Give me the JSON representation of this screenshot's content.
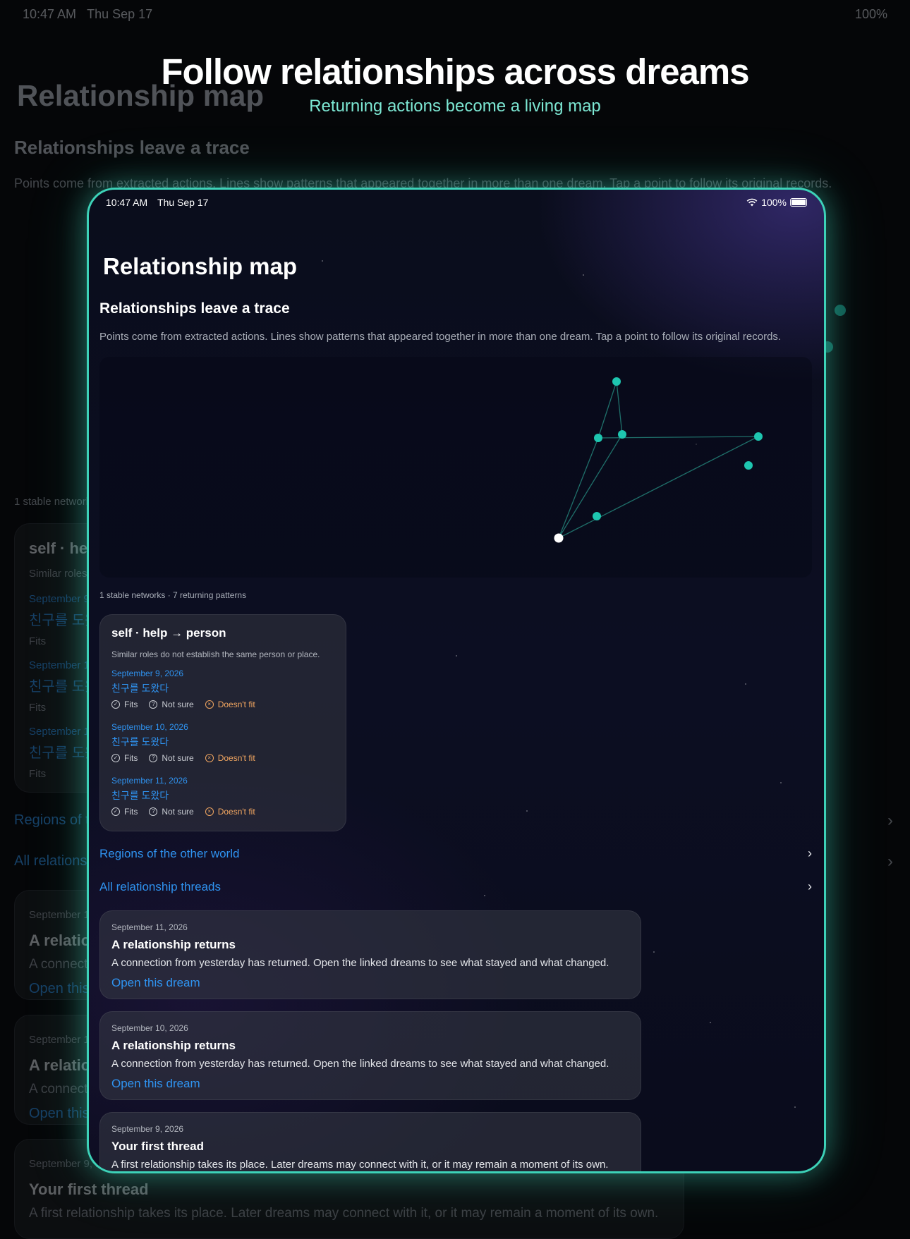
{
  "hero": {
    "title": "Follow relationships across dreams",
    "subtitle": "Returning actions become a living map"
  },
  "status_bar": {
    "time": "10:47 AM",
    "date": "Thu Sep 17",
    "battery": "100%",
    "wifi_icon": "wifi-icon",
    "battery_icon": "battery-icon"
  },
  "page": {
    "title": "Relationship map",
    "section_heading": "Relationships leave a trace",
    "section_description": "Points come from extracted actions. Lines show patterns that appeared together in more than one dream. Tap a point to follow its original records.",
    "network_summary": "1 stable networks · 7 returning patterns"
  },
  "map": {
    "accent_color": "#1ec6b0",
    "selected_color": "#ffffff",
    "line_color": "#1f6f6a"
  },
  "pattern_card": {
    "title": "self · help → person",
    "subtitle": "Similar roles do not establish the same person or place.",
    "occurrences": [
      {
        "date": "September 9, 2026",
        "text": "친구를 도왔다"
      },
      {
        "date": "September 10, 2026",
        "text": "친구를 도왔다"
      },
      {
        "date": "September 11, 2026",
        "text": "친구를 도왔다"
      }
    ],
    "actions": {
      "fits": "Fits",
      "not_sure": "Not sure",
      "doesnt_fit": "Doesn't fit"
    }
  },
  "links": {
    "regions": "Regions of the other world",
    "threads": "All relationship threads"
  },
  "records": [
    {
      "date": "September 11, 2026",
      "title": "A relationship returns",
      "body": "A connection from yesterday has returned. Open the linked dreams to see what stayed and what changed.",
      "open": "Open this dream"
    },
    {
      "date": "September 10, 2026",
      "title": "A relationship returns",
      "body": "A connection from yesterday has returned. Open the linked dreams to see what stayed and what changed.",
      "open": "Open this dream"
    },
    {
      "date": "September 9, 2026",
      "title": "Your first thread",
      "body": "A first relationship takes its place. Later dreams may connect with it, or it may remain a moment of its own.",
      "open": ""
    }
  ],
  "colors": {
    "accent_teal": "#3dd2b8",
    "link_blue": "#2f93f0",
    "warning_orange": "#f0a560"
  }
}
